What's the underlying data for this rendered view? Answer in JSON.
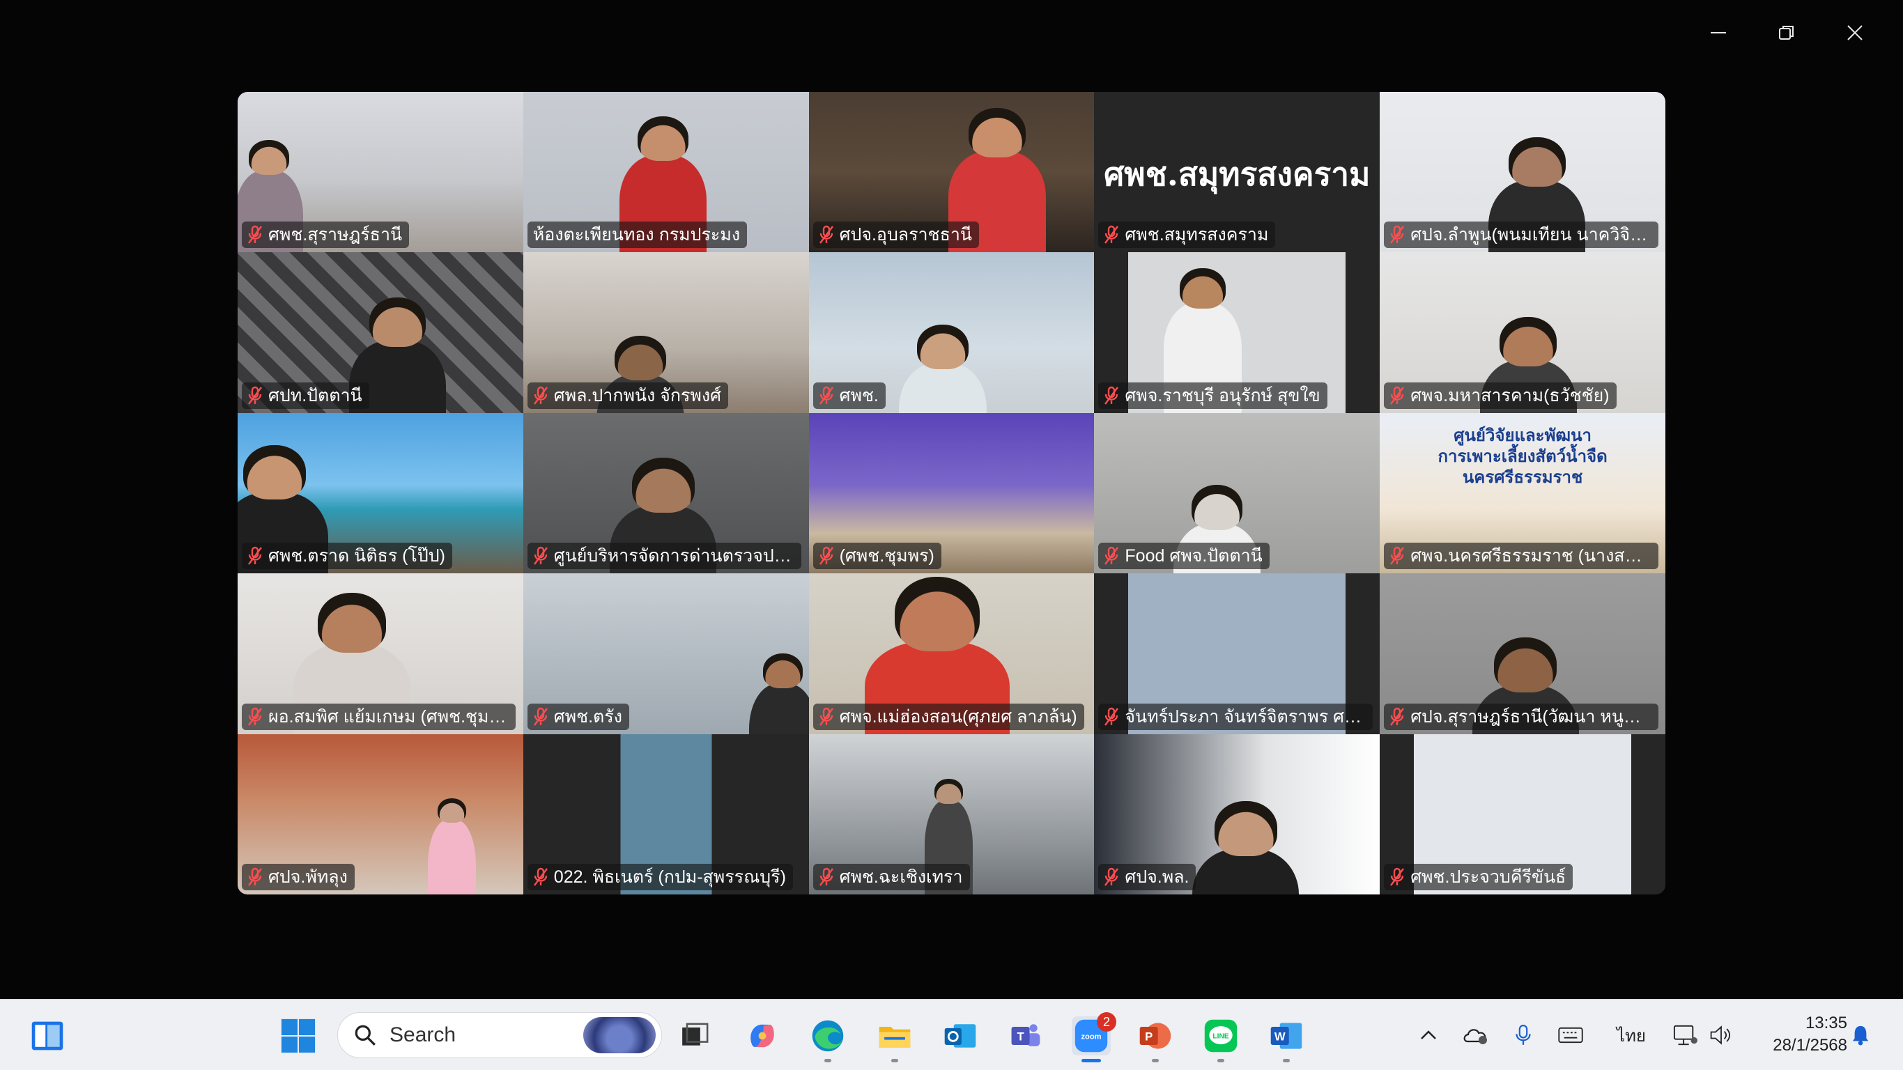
{
  "window": {
    "controls": {
      "minimize": "minimize",
      "restore": "restore",
      "close": "close"
    }
  },
  "participants": [
    {
      "name": "ศพช.สุราษฎร์ธานี",
      "muted": true,
      "active": false
    },
    {
      "name": "ห้องตะเพียนทอง กรมประมง",
      "muted": false,
      "active": true
    },
    {
      "name": "ศปจ.อุบลราชธานี",
      "muted": true,
      "active": false
    },
    {
      "name": "ศพช.สมุทรสงคราม",
      "muted": true,
      "active": false,
      "video_off_title": "ศพช.สมุทรสงคราม"
    },
    {
      "name": "ศปจ.ลำพูน(พนมเทียน นาควิจิตร)",
      "muted": true,
      "active": false
    },
    {
      "name": "ศปท.ปัตตานี",
      "muted": true,
      "active": false
    },
    {
      "name": "ศพล.ปากพนัง จักรพงศ์",
      "muted": true,
      "active": false
    },
    {
      "name": "ศพช.",
      "muted": true,
      "active": false
    },
    {
      "name": "ศพจ.ราชบุรี อนุรักษ์ สุขใข",
      "muted": true,
      "active": false
    },
    {
      "name": "ศพจ.มหาสารคาม(ธวัชชัย)",
      "muted": true,
      "active": false
    },
    {
      "name": "ศพช.ตราด นิติธร (โป๊ป)",
      "muted": true,
      "active": false
    },
    {
      "name": "ศูนย์บริหารจัดการด่านตรวจประมง...",
      "muted": true,
      "active": false
    },
    {
      "name": "(ศพช.ชุมพร)",
      "muted": true,
      "active": false
    },
    {
      "name": "Food ศพจ.ปัตตานี",
      "muted": true,
      "active": false
    },
    {
      "name": "ศพจ.นครศรีธรรมราช (นางสาวนิภ...",
      "muted": true,
      "active": false,
      "banner_line1": "ศูนย์วิจัยและพัฒนา",
      "banner_line2": "การเพาะเลี้ยงสัตว์น้ำจืดนครศรีธรรมราช"
    },
    {
      "name": "ผอ.สมพิศ แย้มเกษม (ศพช.ชุมพร)",
      "muted": true,
      "active": false
    },
    {
      "name": "ศพช.ตรัง",
      "muted": true,
      "active": false
    },
    {
      "name": "ศพจ.แม่ฮ่องสอน(ศุภยศ ลาภล้น)",
      "muted": true,
      "active": false
    },
    {
      "name": "จันทร์ประภา จันทร์จิตราพร ศปปจ...",
      "muted": true,
      "active": false
    },
    {
      "name": "ศปจ.สุราษฎร์ธานี(วัฒนา หนูนิล)",
      "muted": true,
      "active": false
    },
    {
      "name": "ศปจ.พัทลุง",
      "muted": true,
      "active": false
    },
    {
      "name": "022. พิธเนตร์ (กปม-สุพรรณบุรี)",
      "muted": true,
      "active": false
    },
    {
      "name": "ศพช.ฉะเชิงเทรา",
      "muted": true,
      "active": false
    },
    {
      "name": "ศปจ.พล.",
      "muted": true,
      "active": false
    },
    {
      "name": "ศพช.ประจวบคีรีขันธ์",
      "muted": true,
      "active": false
    }
  ],
  "taskbar": {
    "search_placeholder": "Search",
    "zoom_badge": "2",
    "language": "ไทย",
    "time": "13:35",
    "date": "28/1/2568"
  },
  "colors": {
    "active_speaker_border": "#23d96b",
    "muted_icon": "#ff4d4f",
    "taskbar_bg": "#eef0f3"
  }
}
